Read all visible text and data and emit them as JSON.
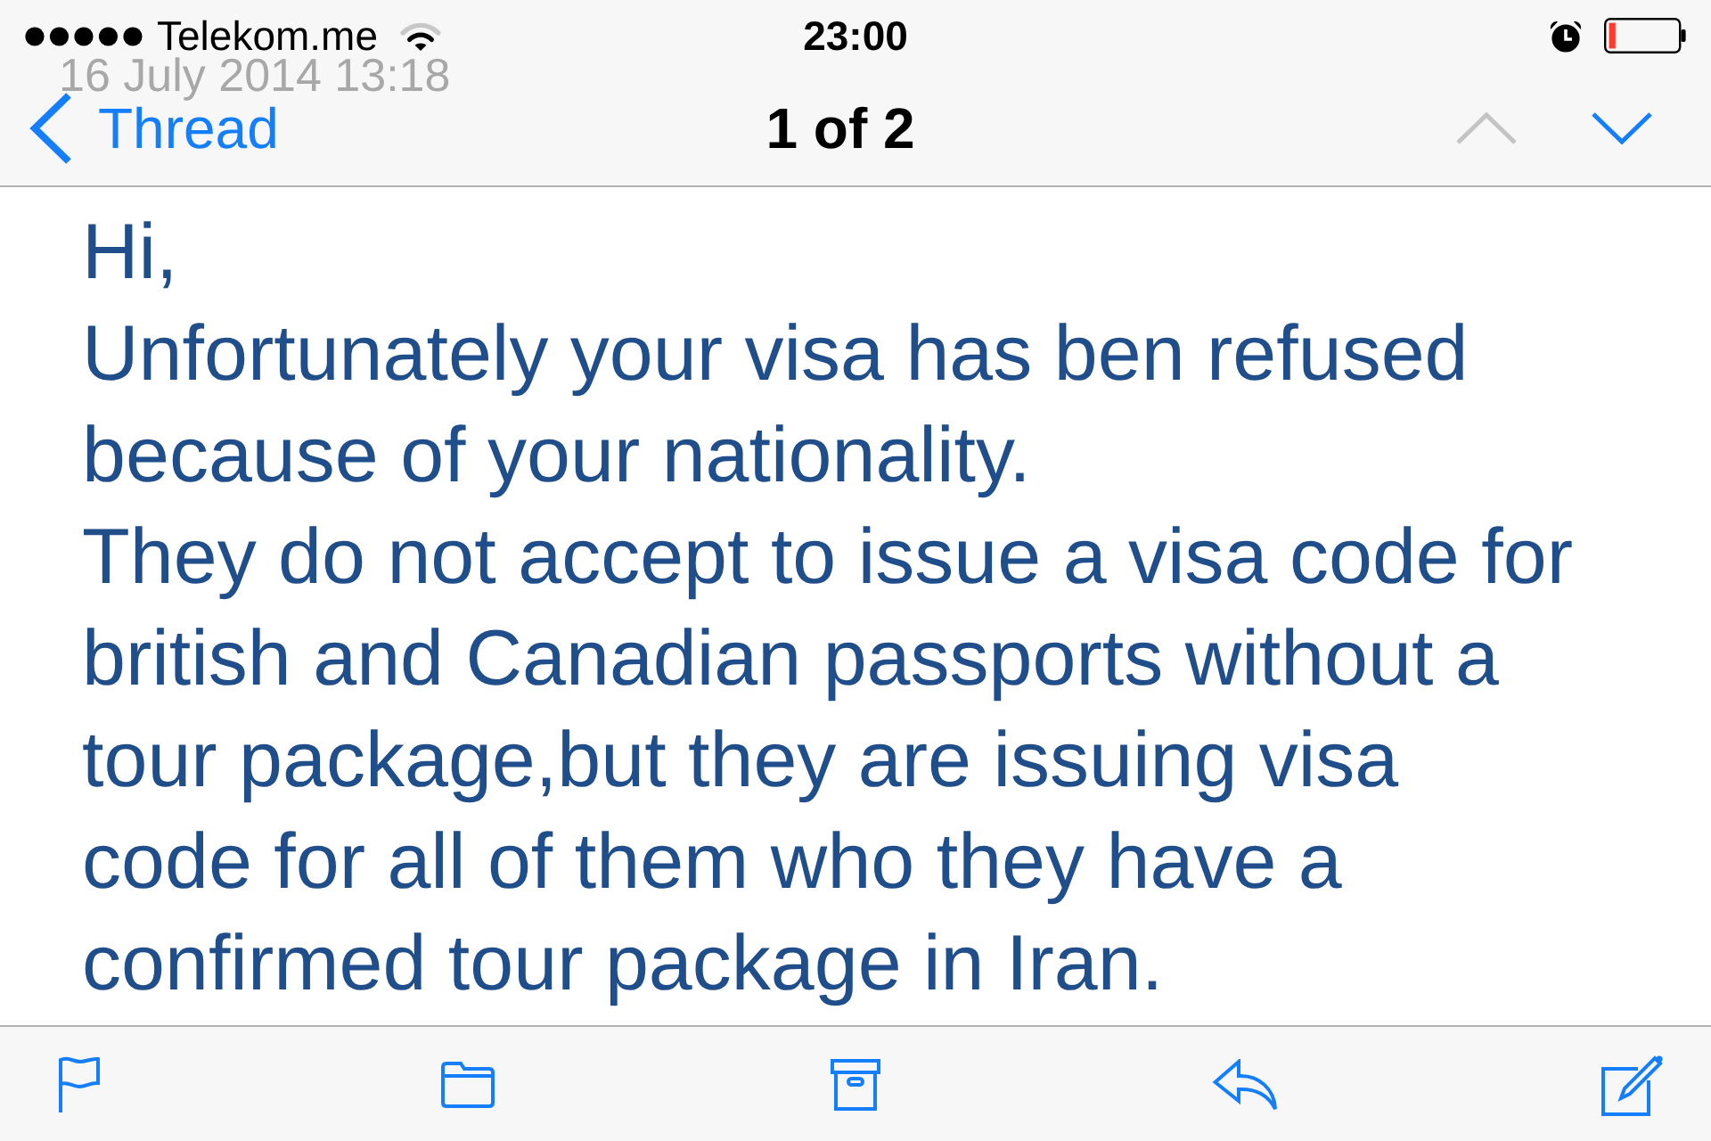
{
  "status_bar": {
    "carrier": "Telekom.me",
    "time": "23:00"
  },
  "background_message": {
    "date": "16 July 2014 13:18"
  },
  "nav_bar": {
    "back_label": "Thread",
    "title": "1 of 2",
    "previous": {
      "disabled": true
    },
    "next": {
      "disabled": false
    }
  },
  "message": {
    "paragraphs": [
      {
        "lines": [
          "Hi,"
        ]
      },
      {
        "lines": [
          "Unfortunately your visa has ben refused",
          "because of your nationality."
        ]
      },
      {
        "lines": [
          "They do not accept to issue a visa code for",
          "british and Canadian passports without a",
          "tour package,but they are issuing visa",
          "code for all of them who they have a",
          "confirmed tour package in Iran."
        ]
      }
    ]
  }
}
